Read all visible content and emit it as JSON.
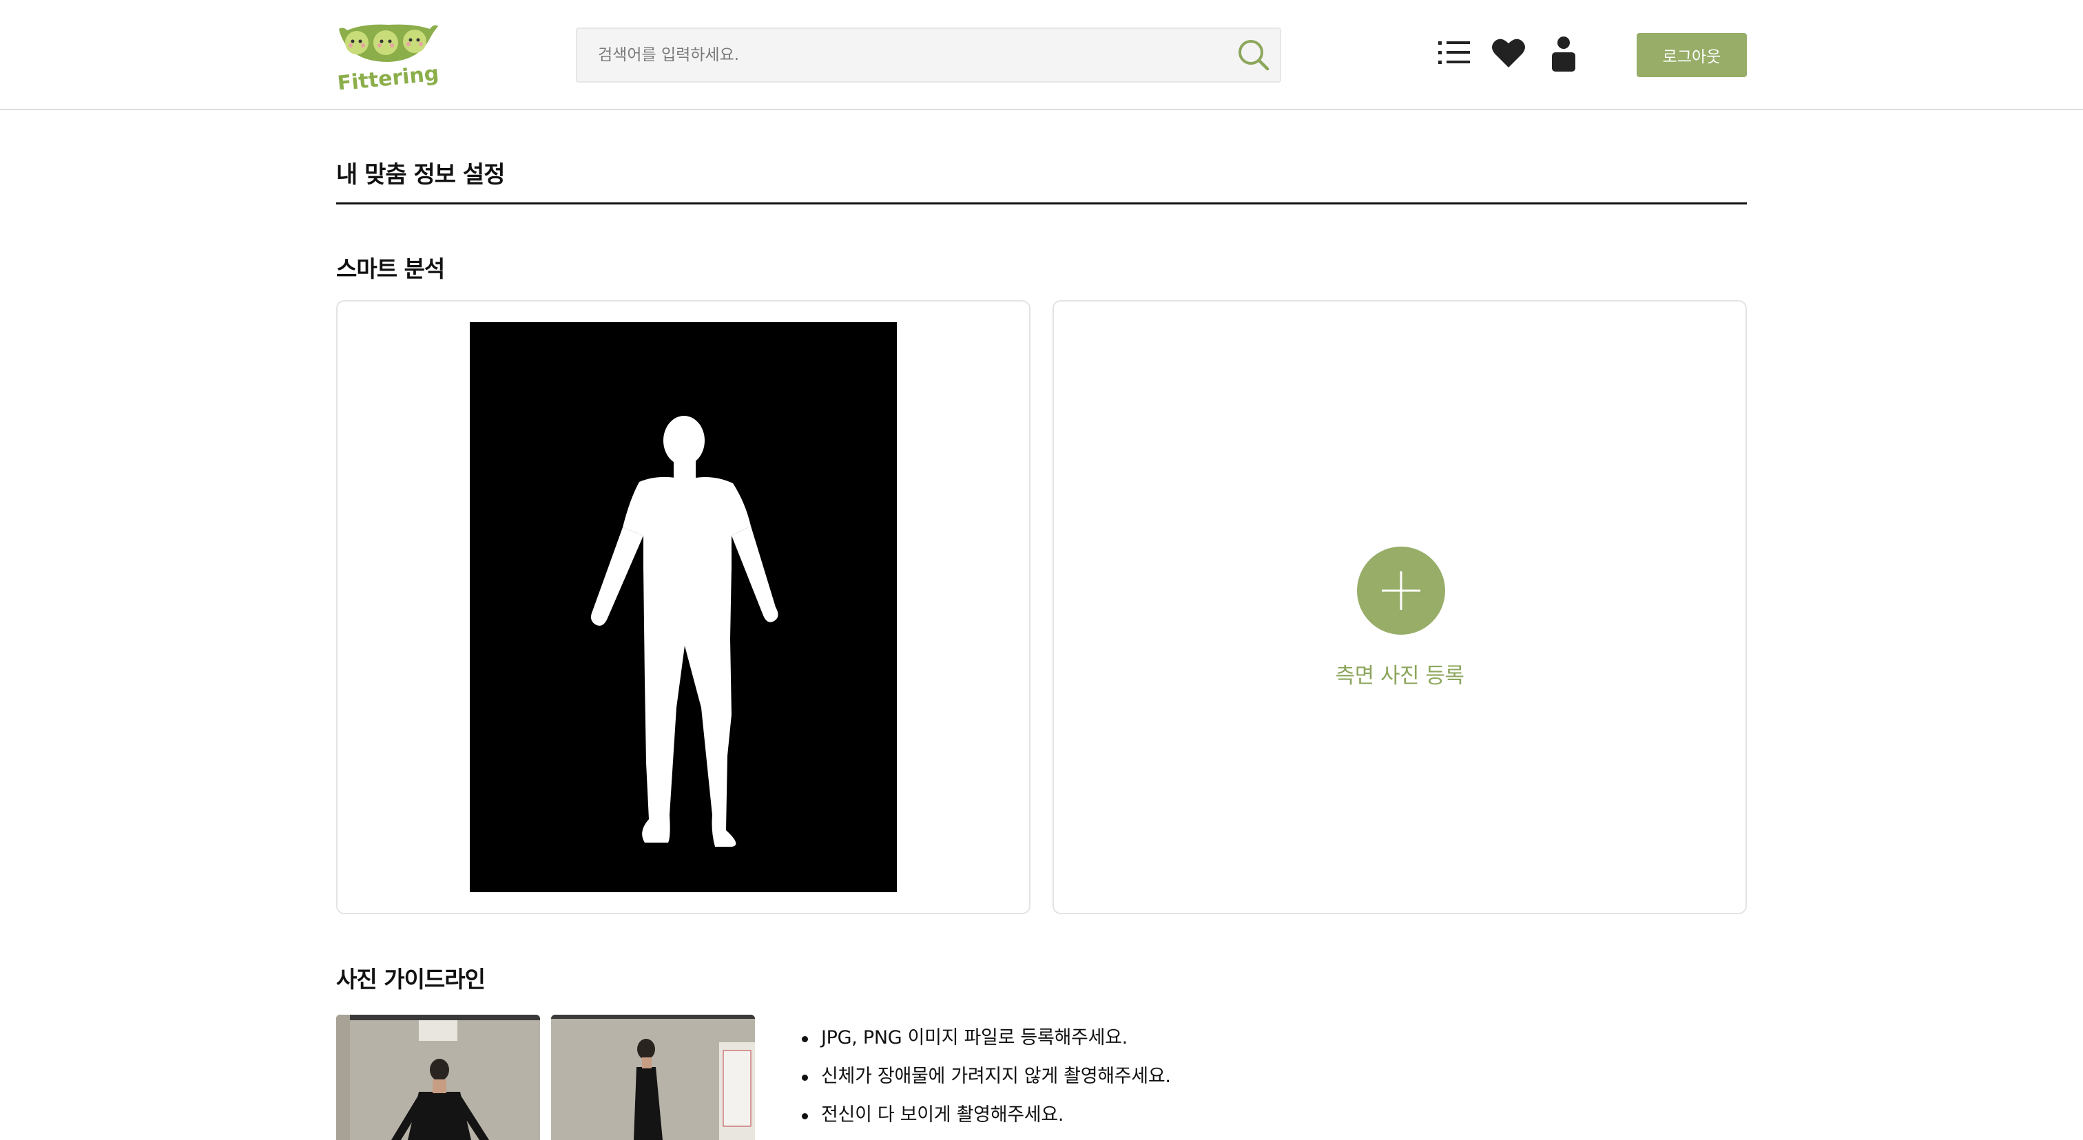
{
  "header": {
    "logo_text": "Fittering",
    "search": {
      "placeholder": "검색어를 입력하세요.",
      "value": ""
    },
    "logout_label": "로그아웃"
  },
  "page": {
    "title": "내 맞춤 정보 설정"
  },
  "smart_analysis": {
    "title": "스마트 분석",
    "front_photo": "front-silhouette-image",
    "side_upload_label": "측면 사진 등록"
  },
  "guideline": {
    "title": "사진 가이드라인",
    "items": [
      "JPG, PNG 이미지 파일로 등록해주세요.",
      "신체가 장애물에 가려지지 않게 촬영해주세요.",
      "전신이 다 보이게 촬영해주세요."
    ]
  },
  "colors": {
    "accent": "#97ad68",
    "accent_text": "#8ca65c",
    "border": "#e3e3e3"
  },
  "icons": [
    "logo-pea-icon",
    "search-icon",
    "list-icon",
    "heart-icon",
    "user-icon",
    "plus-icon"
  ]
}
